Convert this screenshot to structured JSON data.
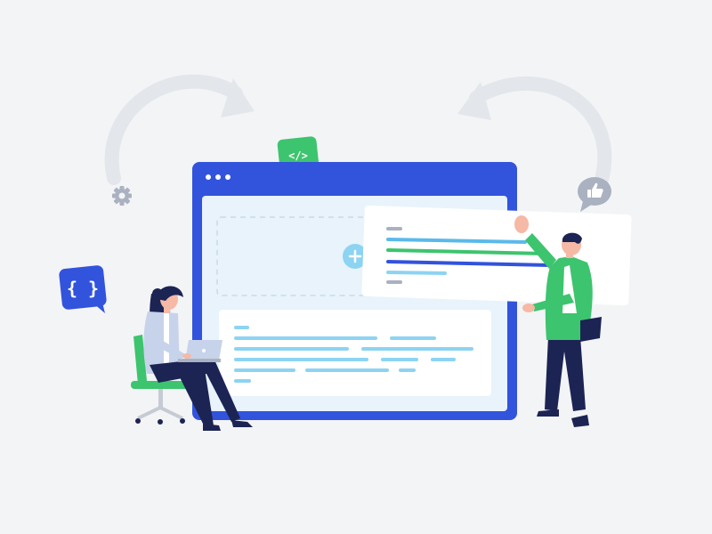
{
  "colors": {
    "background": "#f3f4f6",
    "browser_frame": "#3253dc",
    "browser_panel": "#e8f3fb",
    "card": "#ffffff",
    "accent_green": "#3dc46e",
    "accent_blue": "#3253dc",
    "line_light_blue": "#8dd3f2",
    "line_mid_blue": "#5ab9ea",
    "line_gray": "#aab1c0",
    "arrow_gray": "#e3e6eb",
    "navy": "#1c2454",
    "skin": "#f5b9a6"
  },
  "badges": {
    "code_badge": {
      "icon": "code-tag-icon",
      "glyph": "</>"
    },
    "json_badge": {
      "icon": "curly-braces-icon",
      "glyph": "{ }"
    },
    "like_bubble": {
      "icon": "thumbs-up-icon"
    },
    "settings": {
      "icon": "gear-icon"
    }
  },
  "browser": {
    "window_dots": 3,
    "add_button_icon": "plus-icon"
  },
  "figures": {
    "woman": "woman-with-laptop",
    "man": "man-holding-card"
  }
}
